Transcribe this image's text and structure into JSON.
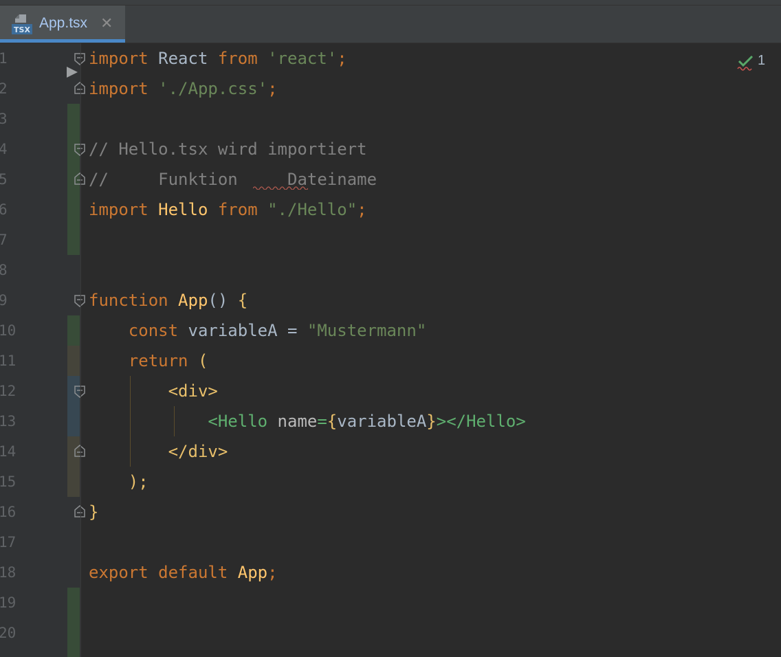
{
  "tab": {
    "icon_label": "TSX",
    "file_name": "App.tsx",
    "close_glyph": "✕"
  },
  "inspections": {
    "count": "1",
    "icon": "check-squiggle-icon"
  },
  "line_numbers": [
    "1",
    "2",
    "3",
    "4",
    "5",
    "6",
    "7",
    "8",
    "9",
    "10",
    "11",
    "12",
    "13",
    "14",
    "15",
    "16",
    "17",
    "18",
    "19",
    "20"
  ],
  "code": {
    "l1": {
      "kw1": "import",
      "t1": " React ",
      "kw2": "from",
      "t2": " ",
      "s": "'react'",
      "t3": ";"
    },
    "l2": {
      "kw1": "import",
      "t1": " ",
      "s": "'./App.css'",
      "t2": ";"
    },
    "l4": {
      "c": "// Hello.tsx wird importiert"
    },
    "l5": {
      "c1": "//     Funktion",
      "c2": "     Dateiname"
    },
    "l6": {
      "kw1": "import",
      "t1": " ",
      "id": "Hello",
      "t2": " ",
      "kw2": "from",
      "t3": " ",
      "s": "\"./Hello\"",
      "t4": ";"
    },
    "l9": {
      "kw": "function",
      "t1": " ",
      "fn": "App",
      "t2": "() ",
      "b": "{"
    },
    "l10": {
      "indent": "    ",
      "kw": "const",
      "t1": " variableA = ",
      "s": "\"Mustermann\""
    },
    "l11": {
      "indent": "    ",
      "kw": "return",
      "t1": " ",
      "p": "("
    },
    "l12": {
      "indent": "        ",
      "tag": "<div>"
    },
    "l13": {
      "indent": "            ",
      "lt": "<",
      "tname": "Hello",
      "t1": " ",
      "attr": "name",
      "eq": "=",
      "lb": "{",
      "v": "variableA",
      "rb": "}",
      "gt": ">",
      "close": "</Hello>"
    },
    "l14": {
      "indent": "        ",
      "tag": "</div>"
    },
    "l15": {
      "indent": "    ",
      "p": ");"
    },
    "l16": {
      "b": "}"
    },
    "l18": {
      "kw1": "export",
      "t1": " ",
      "kw2": "default",
      "t2": " ",
      "fn": "App",
      "t3": ";"
    }
  },
  "colors": {
    "background": "#2b2b2b",
    "gutter": "#313335",
    "keyword": "#cc7832",
    "string": "#6a8759",
    "comment": "#808080",
    "function": "#ffc66d",
    "tag": "#e8bf6a",
    "component_tag": "#5faf6f",
    "vcs_added": "#384c38",
    "vcs_modified": "#45443a",
    "vcs_blue": "#374752",
    "tab_accent": "#4a88c7"
  }
}
